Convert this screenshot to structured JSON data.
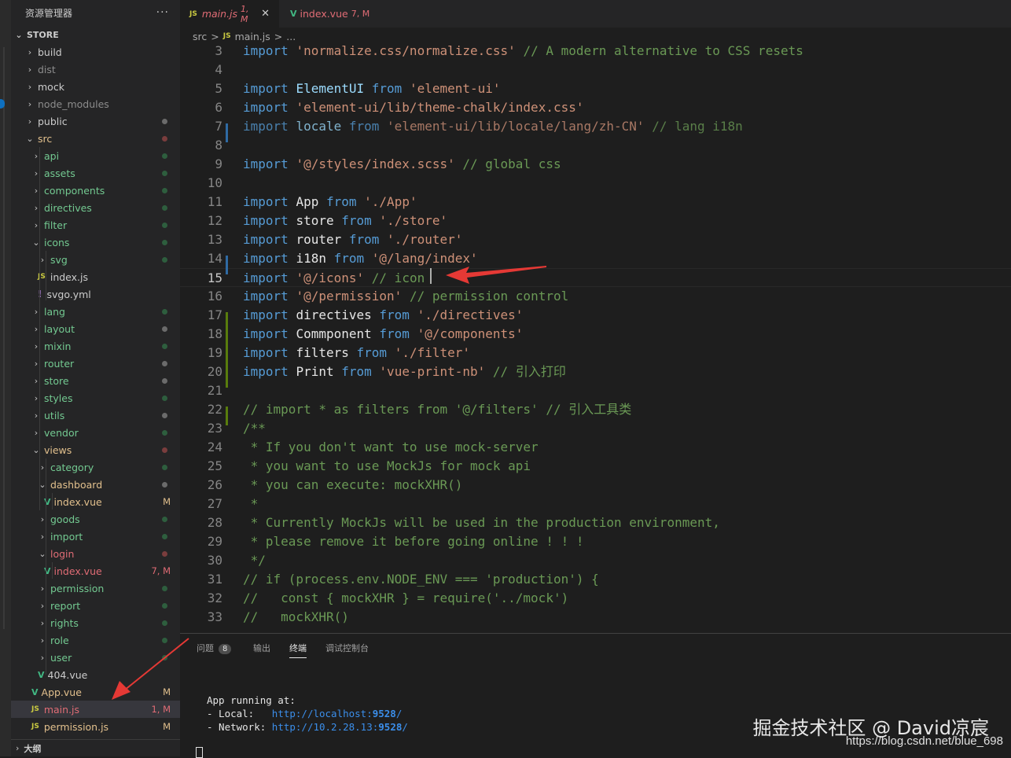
{
  "sidebar": {
    "title": "资源管理器",
    "more": "···",
    "section": "STORE",
    "outline": "大纲",
    "tree": [
      {
        "label": "build",
        "indent": 0,
        "kind": "folder",
        "open": false,
        "color": "#cccccc",
        "dot": ""
      },
      {
        "label": "dist",
        "indent": 0,
        "kind": "folder",
        "open": false,
        "color": "#8c8c8c",
        "dot": ""
      },
      {
        "label": "mock",
        "indent": 0,
        "kind": "folder",
        "open": false,
        "color": "#cccccc",
        "dot": ""
      },
      {
        "label": "node_modules",
        "indent": 0,
        "kind": "folder",
        "open": false,
        "color": "#8c8c8c",
        "dot": ""
      },
      {
        "label": "public",
        "indent": 0,
        "kind": "folder",
        "open": false,
        "color": "#cccccc",
        "dot": "#6b6b6b"
      },
      {
        "label": "src",
        "indent": 0,
        "kind": "folder",
        "open": true,
        "color": "#e2c08d",
        "dot": "#7a3d3d"
      },
      {
        "label": "api",
        "indent": 1,
        "kind": "folder",
        "open": false,
        "color": "#73c991",
        "dot": "#2e5e3e"
      },
      {
        "label": "assets",
        "indent": 1,
        "kind": "folder",
        "open": false,
        "color": "#73c991",
        "dot": "#2e5e3e"
      },
      {
        "label": "components",
        "indent": 1,
        "kind": "folder",
        "open": false,
        "color": "#73c991",
        "dot": "#2e5e3e"
      },
      {
        "label": "directives",
        "indent": 1,
        "kind": "folder",
        "open": false,
        "color": "#73c991",
        "dot": "#2e5e3e"
      },
      {
        "label": "filter",
        "indent": 1,
        "kind": "folder",
        "open": false,
        "color": "#73c991",
        "dot": "#2e5e3e"
      },
      {
        "label": "icons",
        "indent": 1,
        "kind": "folder",
        "open": true,
        "color": "#73c991",
        "dot": "#2e5e3e"
      },
      {
        "label": "svg",
        "indent": 2,
        "kind": "folder",
        "open": false,
        "color": "#73c991",
        "dot": "#2e5e3e"
      },
      {
        "label": "index.js",
        "indent": 2,
        "kind": "js",
        "open": false,
        "color": "#cccccc",
        "dot": ""
      },
      {
        "label": "svgo.yml",
        "indent": 2,
        "kind": "yml",
        "open": false,
        "color": "#cccccc",
        "dot": ""
      },
      {
        "label": "lang",
        "indent": 1,
        "kind": "folder",
        "open": false,
        "color": "#73c991",
        "dot": "#2e5e3e"
      },
      {
        "label": "layout",
        "indent": 1,
        "kind": "folder",
        "open": false,
        "color": "#73c991",
        "dot": "#6b6b6b"
      },
      {
        "label": "mixin",
        "indent": 1,
        "kind": "folder",
        "open": false,
        "color": "#73c991",
        "dot": "#2e5e3e"
      },
      {
        "label": "router",
        "indent": 1,
        "kind": "folder",
        "open": false,
        "color": "#73c991",
        "dot": "#6b6b6b"
      },
      {
        "label": "store",
        "indent": 1,
        "kind": "folder",
        "open": false,
        "color": "#73c991",
        "dot": "#6b6b6b"
      },
      {
        "label": "styles",
        "indent": 1,
        "kind": "folder",
        "open": false,
        "color": "#73c991",
        "dot": "#2e5e3e"
      },
      {
        "label": "utils",
        "indent": 1,
        "kind": "folder",
        "open": false,
        "color": "#73c991",
        "dot": "#6b6b6b"
      },
      {
        "label": "vendor",
        "indent": 1,
        "kind": "folder",
        "open": false,
        "color": "#73c991",
        "dot": "#2e5e3e"
      },
      {
        "label": "views",
        "indent": 1,
        "kind": "folder",
        "open": true,
        "color": "#e2c08d",
        "dot": "#7a3d3d"
      },
      {
        "label": "category",
        "indent": 2,
        "kind": "folder",
        "open": false,
        "color": "#73c991",
        "dot": "#2e5e3e"
      },
      {
        "label": "dashboard",
        "indent": 2,
        "kind": "folder",
        "open": true,
        "color": "#e2c08d",
        "dot": "#6b6b6b"
      },
      {
        "label": "index.vue",
        "indent": 3,
        "kind": "vue",
        "open": false,
        "color": "#e2c08d",
        "status": "M",
        "statusColor": "#e2c08d"
      },
      {
        "label": "goods",
        "indent": 2,
        "kind": "folder",
        "open": false,
        "color": "#73c991",
        "dot": "#2e5e3e"
      },
      {
        "label": "import",
        "indent": 2,
        "kind": "folder",
        "open": false,
        "color": "#73c991",
        "dot": "#2e5e3e"
      },
      {
        "label": "login",
        "indent": 2,
        "kind": "folder",
        "open": true,
        "color": "#e06c75",
        "dot": "#7a3d3d"
      },
      {
        "label": "index.vue",
        "indent": 3,
        "kind": "vue",
        "open": false,
        "color": "#e06c75",
        "status": "7, M",
        "statusColor": "#e06c75"
      },
      {
        "label": "permission",
        "indent": 2,
        "kind": "folder",
        "open": false,
        "color": "#73c991",
        "dot": "#2e5e3e"
      },
      {
        "label": "report",
        "indent": 2,
        "kind": "folder",
        "open": false,
        "color": "#73c991",
        "dot": "#2e5e3e"
      },
      {
        "label": "rights",
        "indent": 2,
        "kind": "folder",
        "open": false,
        "color": "#73c991",
        "dot": "#2e5e3e"
      },
      {
        "label": "role",
        "indent": 2,
        "kind": "folder",
        "open": false,
        "color": "#73c991",
        "dot": "#2e5e3e"
      },
      {
        "label": "user",
        "indent": 2,
        "kind": "folder",
        "open": false,
        "color": "#73c991",
        "dot": "#2e5e3e"
      },
      {
        "label": "404.vue",
        "indent": 2,
        "kind": "vue",
        "open": false,
        "color": "#cccccc",
        "dot": ""
      },
      {
        "label": "App.vue",
        "indent": 1,
        "kind": "vue",
        "open": false,
        "color": "#e2c08d",
        "status": "M",
        "statusColor": "#e2c08d"
      },
      {
        "label": "main.js",
        "indent": 1,
        "kind": "js",
        "open": false,
        "color": "#e06c75",
        "status": "1, M",
        "statusColor": "#e06c75",
        "selected": true
      },
      {
        "label": "permission.js",
        "indent": 1,
        "kind": "js",
        "open": false,
        "color": "#e2c08d",
        "status": "M",
        "statusColor": "#e2c08d"
      }
    ]
  },
  "tabs": [
    {
      "icon": "JS",
      "label": "main.js",
      "status": "1, M",
      "active": true,
      "close": "✕"
    },
    {
      "icon": "V",
      "label": "index.vue",
      "status": "7, M",
      "active": false
    }
  ],
  "breadcrumb": [
    "src",
    ">",
    "JS",
    "main.js",
    ">",
    "..."
  ],
  "editor": {
    "current_line": 15,
    "lines": [
      {
        "n": 3,
        "t": [
          [
            "kw",
            "import"
          ],
          [
            "pl",
            " "
          ],
          [
            "str",
            "'normalize.css/normalize.css'"
          ],
          [
            "pl",
            " "
          ],
          [
            "cm",
            "// A modern alternative to CSS resets"
          ]
        ]
      },
      {
        "n": 4,
        "t": []
      },
      {
        "n": 5,
        "t": [
          [
            "kw",
            "import"
          ],
          [
            "pl",
            " "
          ],
          [
            "id",
            "ElementUI"
          ],
          [
            "pl",
            " "
          ],
          [
            "kw",
            "from"
          ],
          [
            "pl",
            " "
          ],
          [
            "str",
            "'element-ui'"
          ]
        ]
      },
      {
        "n": 6,
        "t": [
          [
            "kw",
            "import"
          ],
          [
            "pl",
            " "
          ],
          [
            "str",
            "'element-ui/lib/theme-chalk/index.css'"
          ]
        ]
      },
      {
        "n": 7,
        "t": [
          [
            "kw",
            "import"
          ],
          [
            "pl",
            " "
          ],
          [
            "id",
            "locale"
          ],
          [
            "pl",
            " "
          ],
          [
            "kw",
            "from"
          ],
          [
            "pl",
            " "
          ],
          [
            "str",
            "'element-ui/lib/locale/lang/zh-CN'"
          ],
          [
            "pl",
            " "
          ],
          [
            "cm",
            "// lang i18n"
          ]
        ],
        "dim": true
      },
      {
        "n": 8,
        "t": []
      },
      {
        "n": 9,
        "t": [
          [
            "kw",
            "import"
          ],
          [
            "pl",
            " "
          ],
          [
            "str",
            "'@/styles/index.scss'"
          ],
          [
            "pl",
            " "
          ],
          [
            "cm",
            "// global css"
          ]
        ]
      },
      {
        "n": 10,
        "t": []
      },
      {
        "n": 11,
        "t": [
          [
            "kw",
            "import"
          ],
          [
            "pl",
            " "
          ],
          [
            "wh",
            "App"
          ],
          [
            "pl",
            " "
          ],
          [
            "kw",
            "from"
          ],
          [
            "pl",
            " "
          ],
          [
            "str",
            "'./App'"
          ]
        ]
      },
      {
        "n": 12,
        "t": [
          [
            "kw",
            "import"
          ],
          [
            "pl",
            " "
          ],
          [
            "wh",
            "store"
          ],
          [
            "pl",
            " "
          ],
          [
            "kw",
            "from"
          ],
          [
            "pl",
            " "
          ],
          [
            "str",
            "'./store'"
          ]
        ]
      },
      {
        "n": 13,
        "t": [
          [
            "kw",
            "import"
          ],
          [
            "pl",
            " "
          ],
          [
            "wh",
            "router"
          ],
          [
            "pl",
            " "
          ],
          [
            "kw",
            "from"
          ],
          [
            "pl",
            " "
          ],
          [
            "str",
            "'./router'"
          ]
        ]
      },
      {
        "n": 14,
        "t": [
          [
            "kw",
            "import"
          ],
          [
            "pl",
            " "
          ],
          [
            "wh",
            "i18n"
          ],
          [
            "pl",
            " "
          ],
          [
            "kw",
            "from"
          ],
          [
            "pl",
            " "
          ],
          [
            "str",
            "'@/lang/index'"
          ]
        ]
      },
      {
        "n": 15,
        "t": [
          [
            "kw",
            "import"
          ],
          [
            "pl",
            " "
          ],
          [
            "str",
            "'@/icons'"
          ],
          [
            "pl",
            " "
          ],
          [
            "cm",
            "// icon"
          ]
        ]
      },
      {
        "n": 16,
        "t": [
          [
            "kw",
            "import"
          ],
          [
            "pl",
            " "
          ],
          [
            "str",
            "'@/permission'"
          ],
          [
            "pl",
            " "
          ],
          [
            "cm",
            "// permission control"
          ]
        ]
      },
      {
        "n": 17,
        "t": [
          [
            "kw",
            "import"
          ],
          [
            "pl",
            " "
          ],
          [
            "wh",
            "directives"
          ],
          [
            "pl",
            " "
          ],
          [
            "kw",
            "from"
          ],
          [
            "pl",
            " "
          ],
          [
            "str",
            "'./directives'"
          ]
        ]
      },
      {
        "n": 18,
        "t": [
          [
            "kw",
            "import"
          ],
          [
            "pl",
            " "
          ],
          [
            "wh",
            "Commponent"
          ],
          [
            "pl",
            " "
          ],
          [
            "kw",
            "from"
          ],
          [
            "pl",
            " "
          ],
          [
            "str",
            "'@/components'"
          ]
        ]
      },
      {
        "n": 19,
        "t": [
          [
            "kw",
            "import"
          ],
          [
            "pl",
            " "
          ],
          [
            "wh",
            "filters"
          ],
          [
            "pl",
            " "
          ],
          [
            "kw",
            "from"
          ],
          [
            "pl",
            " "
          ],
          [
            "str",
            "'./filter'"
          ]
        ]
      },
      {
        "n": 20,
        "t": [
          [
            "kw",
            "import"
          ],
          [
            "pl",
            " "
          ],
          [
            "wh",
            "Print"
          ],
          [
            "pl",
            " "
          ],
          [
            "kw",
            "from"
          ],
          [
            "pl",
            " "
          ],
          [
            "str",
            "'vue-print-nb'"
          ],
          [
            "pl",
            " "
          ],
          [
            "cm",
            "// 引入打印"
          ]
        ]
      },
      {
        "n": 21,
        "t": []
      },
      {
        "n": 22,
        "t": [
          [
            "cm",
            "// import * as filters from '@/filters' // 引入工具类"
          ]
        ]
      },
      {
        "n": 23,
        "t": [
          [
            "cm",
            "/**"
          ]
        ]
      },
      {
        "n": 24,
        "t": [
          [
            "cm",
            " * If you don't want to use mock-server"
          ]
        ]
      },
      {
        "n": 25,
        "t": [
          [
            "cm",
            " * you want to use MockJs for mock api"
          ]
        ]
      },
      {
        "n": 26,
        "t": [
          [
            "cm",
            " * you can execute: mockXHR()"
          ]
        ]
      },
      {
        "n": 27,
        "t": [
          [
            "cm",
            " *"
          ]
        ]
      },
      {
        "n": 28,
        "t": [
          [
            "cm",
            " * Currently MockJs will be used in the production environment,"
          ]
        ]
      },
      {
        "n": 29,
        "t": [
          [
            "cm",
            " * please remove it before going online ! ! !"
          ]
        ]
      },
      {
        "n": 30,
        "t": [
          [
            "cm",
            " */"
          ]
        ]
      },
      {
        "n": 31,
        "t": [
          [
            "cm",
            "// if (process.env.NODE_ENV === 'production') {"
          ]
        ]
      },
      {
        "n": 32,
        "t": [
          [
            "cm",
            "//   const { mockXHR } = require('../mock')"
          ]
        ]
      },
      {
        "n": 33,
        "t": [
          [
            "cm",
            "//   mockXHR()"
          ]
        ]
      }
    ]
  },
  "panel": {
    "tabs": [
      {
        "label": "问题",
        "badge": "8",
        "active": false
      },
      {
        "label": "输出",
        "active": false
      },
      {
        "label": "终端",
        "active": true
      },
      {
        "label": "调试控制台",
        "active": false
      }
    ],
    "terminal": {
      "l1": "App running at:",
      "local_label": "- Local:   ",
      "local_url": "http://localhost:",
      "local_port": "9528",
      "local_tail": "/",
      "network_label": "- Network: ",
      "network_url": "http://10.2.28.13:",
      "network_port": "9528",
      "network_tail": "/"
    }
  },
  "watermark": {
    "line1": "掘金技术社区 @ David凉宸",
    "line2": "https://blog.csdn.net/blue_698"
  },
  "colors": {
    "arrow": "#e53935"
  }
}
